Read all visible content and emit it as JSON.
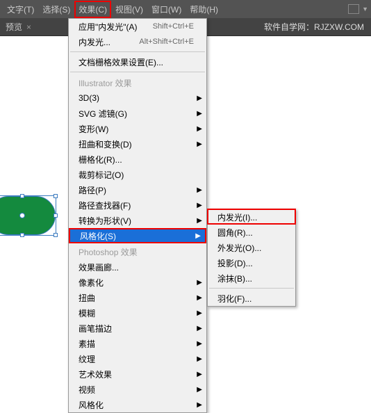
{
  "menubar": {
    "items": [
      {
        "label": "文字(T)"
      },
      {
        "label": "选择(S)"
      },
      {
        "label": "效果(C)"
      },
      {
        "label": "视图(V)"
      },
      {
        "label": "窗口(W)"
      },
      {
        "label": "帮助(H)"
      }
    ]
  },
  "tabbar": {
    "tab_label": "预览",
    "watermark": "软件自学网：RJZXW.COM"
  },
  "menu_effect": {
    "r1": {
      "label": "应用\"内发光\"(A)",
      "shortcut": "Shift+Ctrl+E"
    },
    "r2": {
      "label": "内发光...",
      "shortcut": "Alt+Shift+Ctrl+E"
    },
    "r3": {
      "label": "文档栅格效果设置(E)..."
    },
    "h1": "Illustrator 效果",
    "g1": [
      {
        "label": "3D(3)",
        "arrow": true
      },
      {
        "label": "SVG 滤镜(G)",
        "arrow": true
      },
      {
        "label": "变形(W)",
        "arrow": true
      },
      {
        "label": "扭曲和变换(D)",
        "arrow": true
      },
      {
        "label": "栅格化(R)..."
      },
      {
        "label": "裁剪标记(O)"
      },
      {
        "label": "路径(P)",
        "arrow": true
      },
      {
        "label": "路径查找器(F)",
        "arrow": true
      },
      {
        "label": "转换为形状(V)",
        "arrow": true
      },
      {
        "label": "风格化(S)",
        "arrow": true
      }
    ],
    "h2": "Photoshop 效果",
    "g2": [
      {
        "label": "效果画廊..."
      },
      {
        "label": "像素化",
        "arrow": true
      },
      {
        "label": "扭曲",
        "arrow": true
      },
      {
        "label": "模糊",
        "arrow": true
      },
      {
        "label": "画笔描边",
        "arrow": true
      },
      {
        "label": "素描",
        "arrow": true
      },
      {
        "label": "纹理",
        "arrow": true
      },
      {
        "label": "艺术效果",
        "arrow": true
      },
      {
        "label": "视频",
        "arrow": true
      },
      {
        "label": "风格化",
        "arrow": true
      }
    ]
  },
  "submenu_stylize": {
    "items": [
      {
        "label": "内发光(I)..."
      },
      {
        "label": "圆角(R)..."
      },
      {
        "label": "外发光(O)..."
      },
      {
        "label": "投影(D)..."
      },
      {
        "label": "涂抹(B)..."
      },
      {
        "label": "羽化(F)..."
      }
    ]
  }
}
